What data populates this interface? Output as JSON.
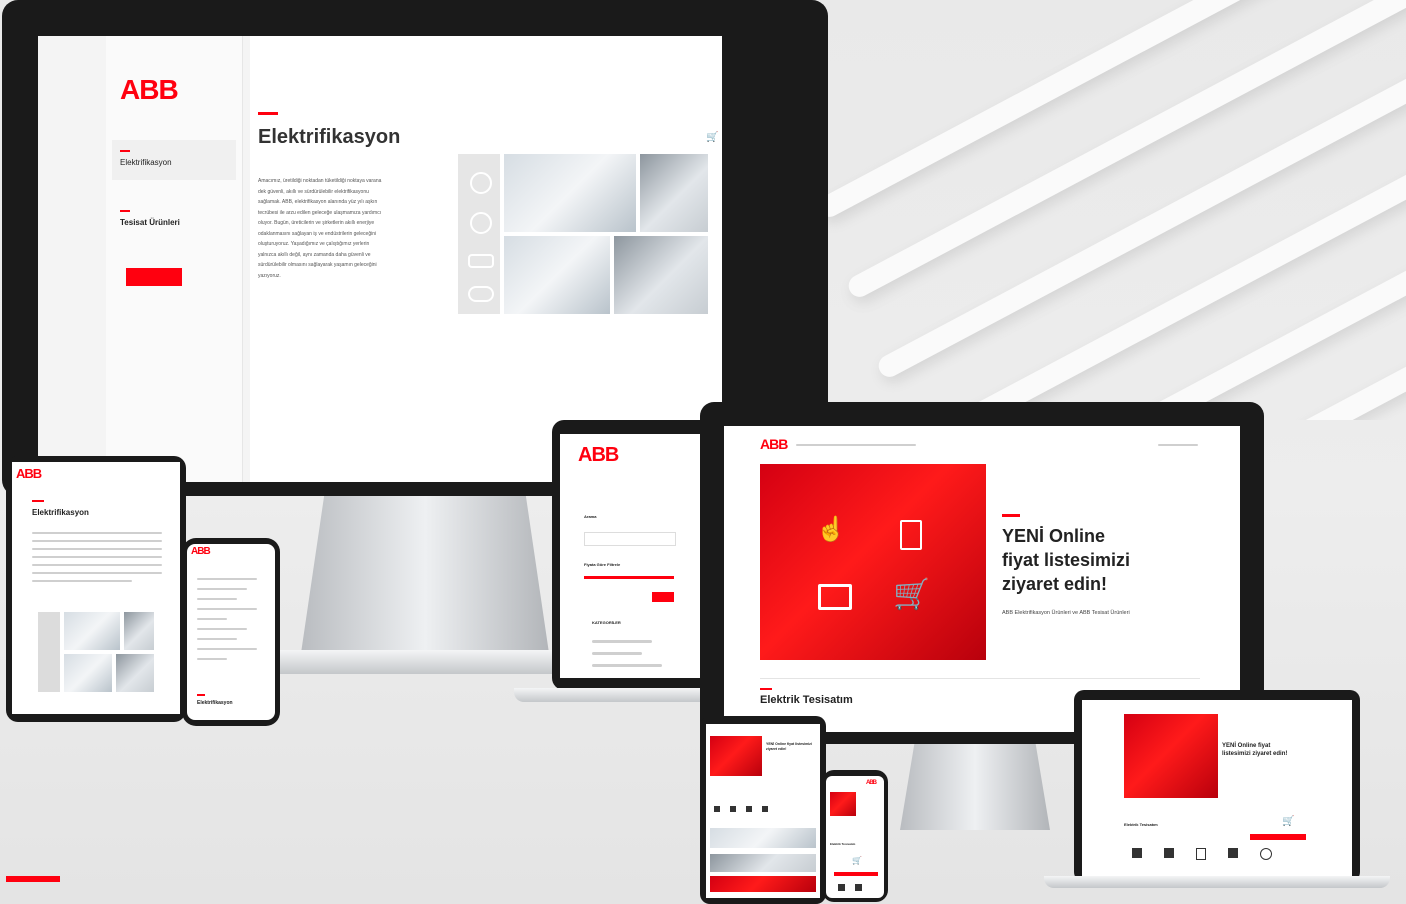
{
  "big_monitor": {
    "logo": "ABB",
    "sidebar_items": [
      "Elektrifikasyon",
      "Tesisat Ürünleri"
    ],
    "heading": "Elektrifikasyon",
    "body_text": "Amacımız, üretildiği noktadan tüketildiği noktaya varana dek güvenli, akıllı ve sürdürülebilir elektrifikasyonu sağlamak. ABB, elektrifikasyon alanında yüz yılı aşkın tecrübesi ile arzu edilen geleceğe ulaşmamıza yardımcı oluyor. Bugün, üreticilerin ve şirketlerin akıllı enerjiye odaklanmasını sağlayan iş ve endüstrilerin geleceğini oluşturuyoruz. Yaşadığımız ve çalıştığımız yerlerin yalnızca akıllı değil, aynı zamanda daha güvenli ve sürdürülebilir olmasını sağlayarak yaşamın geleceğini yazıyoruz."
  },
  "laptop": {
    "logo": "ABB",
    "search_label": "Arama",
    "price_label": "Fiyata Göre Filtrele",
    "category_label": "KATEGORİLER"
  },
  "right_monitor": {
    "logo": "ABB",
    "headline_line1": "YENİ Online",
    "headline_line2": "fiyat listesimizi",
    "headline_line3": "ziyaret edin!",
    "subline": "ABB Elektrifikasyon Ürünleri ve ABB Tesisat Ürünleri",
    "section_title": "Elektrik Tesisatım"
  },
  "left_tablet": {
    "logo": "ABB",
    "heading": "Elektrifikasyon"
  },
  "left_phone": {
    "logo": "ABB",
    "footer": "Elektrifikasyon"
  },
  "small_laptop": {
    "headline": "YENİ Online fiyat listesimizi ziyaret edin!",
    "section_title": "Elektrik Tesisatım"
  },
  "small_tablet": {
    "headline": "YENİ Online fiyat listesimizi ziyaret edin!"
  },
  "small_phone": {
    "logo": "ABB",
    "section_title": "Elektrik Tesisatım"
  },
  "colors": {
    "brand": "#ff000f",
    "dark": "#1a1a1a"
  }
}
